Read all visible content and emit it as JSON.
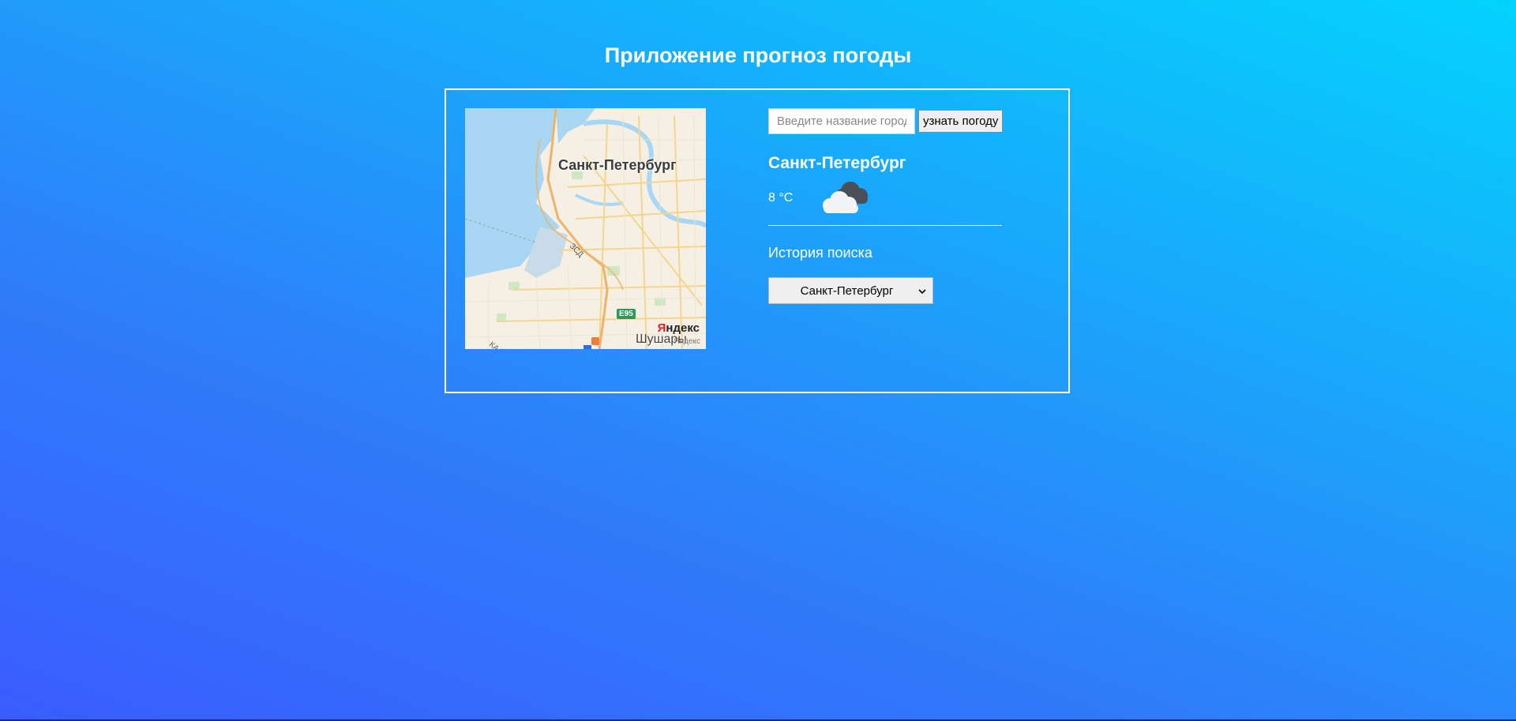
{
  "title": "Приложение прогноз погоды",
  "map": {
    "city_label": "Санкт-Петербург",
    "district_label": "Шушары",
    "road_label": "E95",
    "ring_road_label": "ЗСД",
    "kad_label": "КАД",
    "logo_text": "Яндекс",
    "logo_small": "Яндекс"
  },
  "search": {
    "placeholder": "Введите название города",
    "button_label": "узнать погоду"
  },
  "weather": {
    "city": "Санкт-Петербург",
    "temperature": "8 °C",
    "icon": "cloudy-icon"
  },
  "history": {
    "label": "История поиска",
    "selected": "Санкт-Петербург"
  },
  "colors": {
    "background_start": "#3a5cff",
    "background_end": "#04d3fd",
    "text": "#ffffff",
    "panel_border": "#ffffff"
  }
}
